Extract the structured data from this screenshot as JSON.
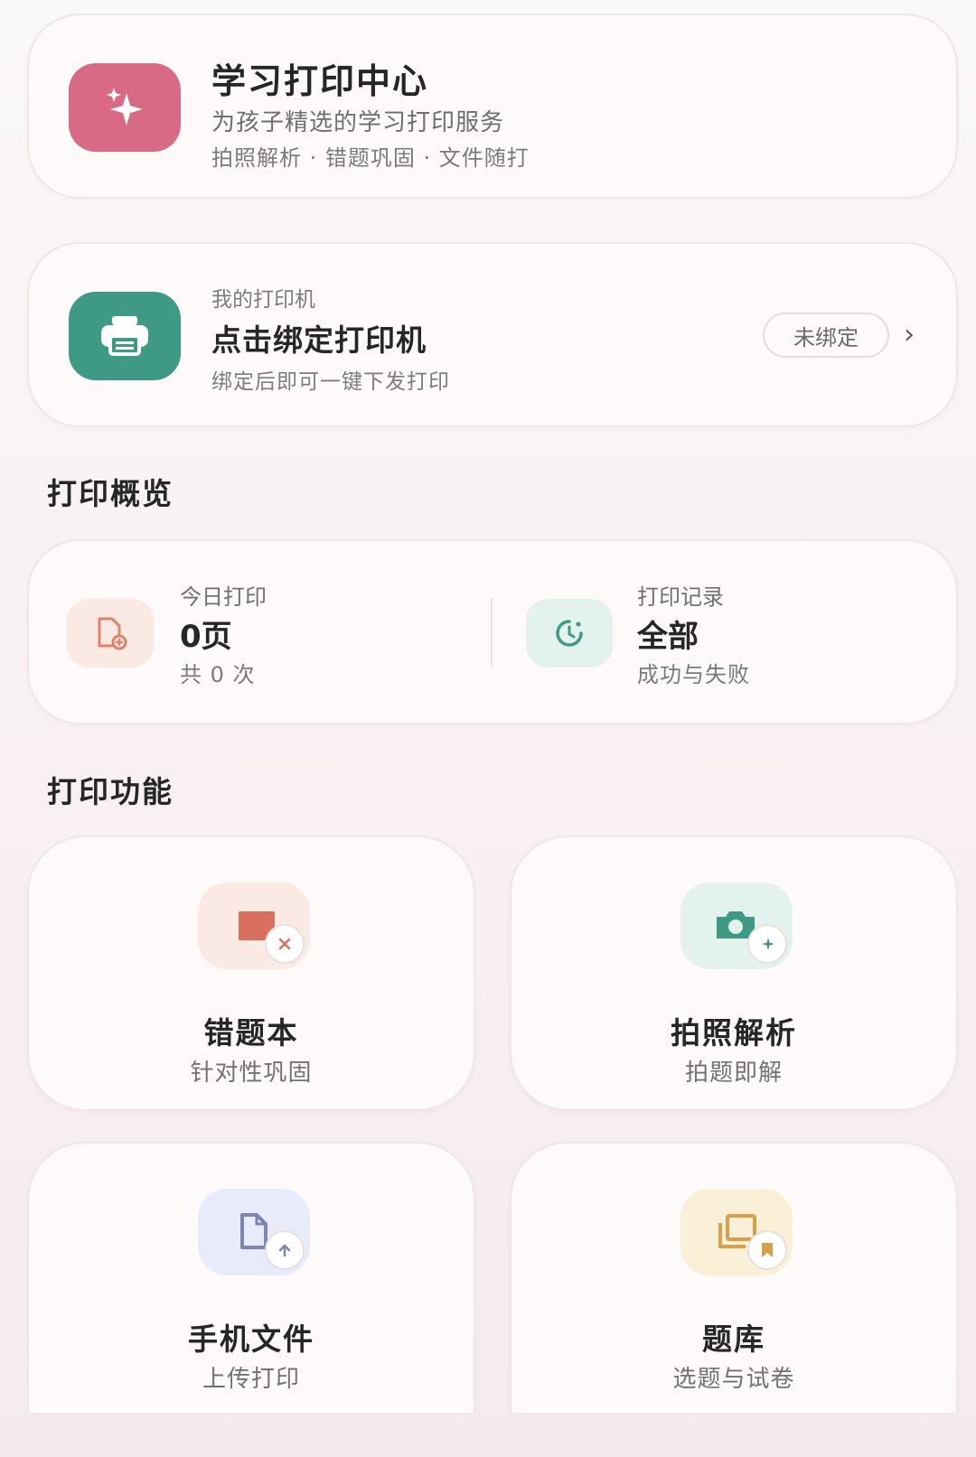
{
  "header": {
    "title": "学习打印中心",
    "subtitle": "为孩子精选的学习打印服务",
    "tags": "拍照解析 · 错题巩固 · 文件随打",
    "icon": "sparkles-icon"
  },
  "printer": {
    "caption": "我的打印机",
    "title": "点击绑定打印机",
    "hint": "绑定后即可一键下发打印",
    "status": "未绑定",
    "chevron": "›",
    "icon": "printer-icon"
  },
  "overview": {
    "section_title": "打印概览",
    "today": {
      "label": "今日打印",
      "value": "0页",
      "sub": "共 0 次",
      "icon": "document-add-icon"
    },
    "history": {
      "label": "打印记录",
      "value": "全部",
      "sub": "成功与失败",
      "icon": "history-clock-icon"
    }
  },
  "functions": {
    "section_title": "打印功能",
    "tiles": [
      {
        "title": "错题本",
        "sub": "针对性巩固",
        "icon": "mistake-book-icon"
      },
      {
        "title": "拍照解析",
        "sub": "拍题即解",
        "icon": "camera-sparkle-icon"
      },
      {
        "title": "手机文件",
        "sub": "上传打印",
        "icon": "file-upload-icon"
      },
      {
        "title": "题库",
        "sub": "选题与试卷",
        "icon": "question-bank-icon"
      }
    ]
  },
  "colors": {
    "header_icon_bg": "#d96a86",
    "printer_icon_bg": "#3f9a85",
    "mistake_accent": "#d9705f",
    "photo_accent": "#3f9a85",
    "file_accent": "#7c86b0",
    "bank_accent": "#d6a04a"
  }
}
